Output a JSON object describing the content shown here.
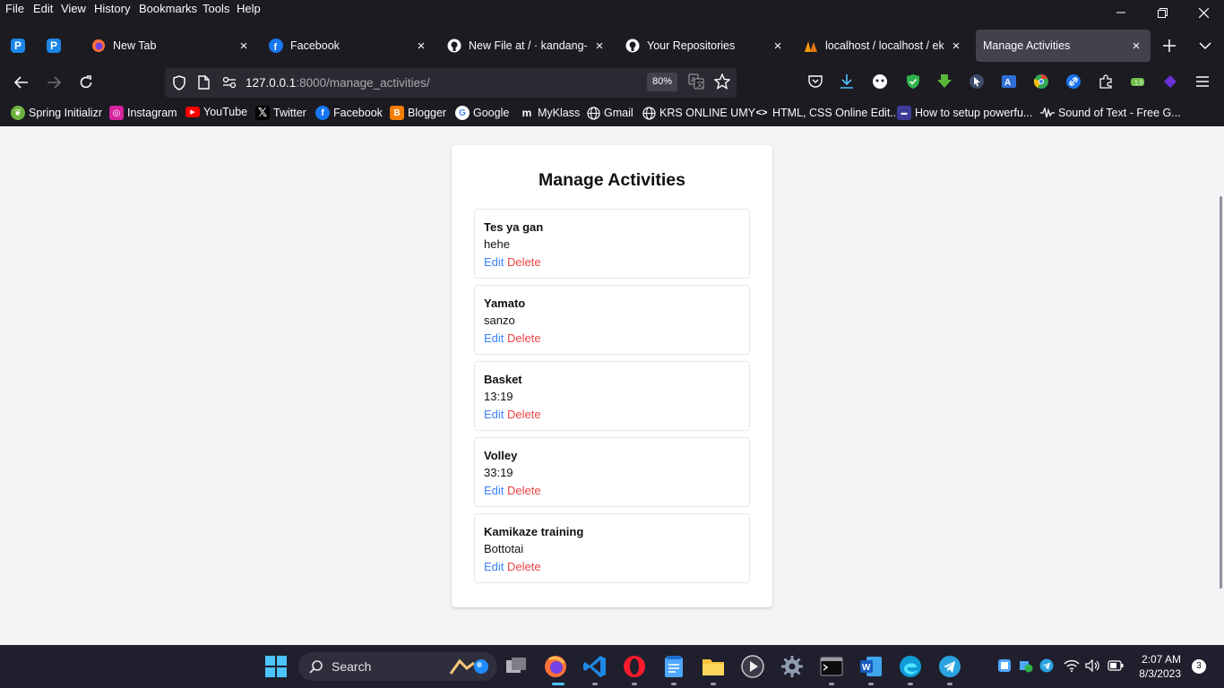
{
  "menubar": {
    "items": [
      "File",
      "Edit",
      "View",
      "History",
      "Bookmarks",
      "Tools",
      "Help"
    ]
  },
  "window_controls": {
    "minimize_icon": "minimize-icon",
    "restore_icon": "restore-icon",
    "close_icon": "close-icon"
  },
  "tabs": [
    {
      "title": "New Tab",
      "icon": "firefox-icon",
      "active": false
    },
    {
      "title": "Facebook",
      "icon": "facebook-icon",
      "active": false
    },
    {
      "title": "New File at / · kandang-ul",
      "icon": "github-icon",
      "active": false
    },
    {
      "title": "Your Repositories",
      "icon": "github-icon",
      "active": false
    },
    {
      "title": "localhost / localhost / ekst",
      "icon": "phpmyadmin-icon",
      "active": false
    },
    {
      "title": "Manage Activities",
      "icon": "",
      "active": true
    }
  ],
  "pinned_tabs": [
    {
      "label": "P"
    },
    {
      "label": "P"
    }
  ],
  "navbar": {
    "url_host": "127.0.0.1",
    "url_path": ":8000/manage_activities/",
    "zoom": "80%"
  },
  "bookmarks": [
    {
      "label": "Spring Initializr",
      "color": "#6db33f"
    },
    {
      "label": "Instagram",
      "color": "#d6249f"
    },
    {
      "label": "YouTube",
      "color": "#ff0000"
    },
    {
      "label": "Twitter",
      "color": "#000000"
    },
    {
      "label": "Facebook",
      "color": "#1877f2"
    },
    {
      "label": "Blogger",
      "color": "#f57d00"
    },
    {
      "label": "Google",
      "color": "#ffffff"
    },
    {
      "label": "MyKlass",
      "color": "#1c1b22"
    },
    {
      "label": "Gmail",
      "color": "#1c1b22"
    },
    {
      "label": "KRS ONLINE UMY",
      "color": "#1c1b22"
    },
    {
      "label": "HTML, CSS Online Edit...",
      "color": "#1c1b22"
    },
    {
      "label": "How to setup powerfu...",
      "color": "#3b3b9a"
    },
    {
      "label": "Sound of Text - Free G...",
      "color": "#1c1b22"
    }
  ],
  "page": {
    "title": "Manage Activities",
    "activities": [
      {
        "name": "Tes ya gan",
        "description": "hehe",
        "edit_label": "Edit",
        "delete_label": "Delete"
      },
      {
        "name": "Yamato",
        "description": "sanzo",
        "edit_label": "Edit",
        "delete_label": "Delete"
      },
      {
        "name": "Basket",
        "description": "13:19",
        "edit_label": "Edit",
        "delete_label": "Delete"
      },
      {
        "name": "Volley",
        "description": "33:19",
        "edit_label": "Edit",
        "delete_label": "Delete"
      },
      {
        "name": "Kamikaze training",
        "description": "Bottotai",
        "edit_label": "Edit",
        "delete_label": "Delete"
      }
    ]
  },
  "taskbar": {
    "search_label": "Search",
    "time": "2:07 AM",
    "date": "8/3/2023",
    "notification_count": "3"
  },
  "colors": {
    "edit_link": "#3b82f6",
    "delete_link": "#ef4444",
    "chrome_bg": "#1c1b22",
    "page_bg": "#f3f4f6"
  }
}
